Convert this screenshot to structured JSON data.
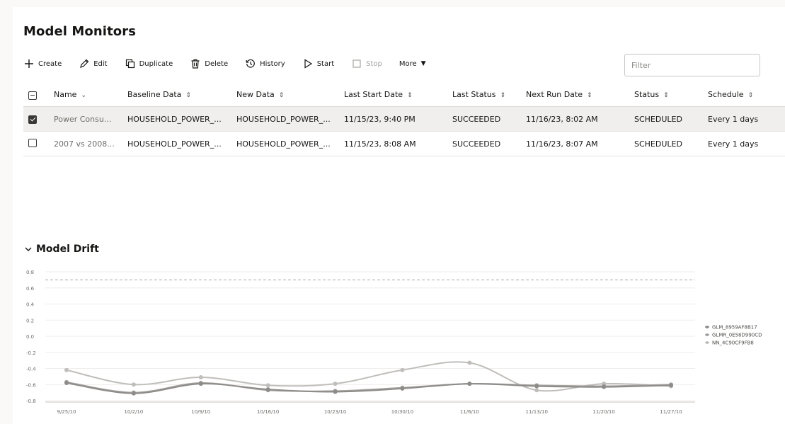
{
  "title": "Model Monitors",
  "toolbar": {
    "create": "Create",
    "edit": "Edit",
    "duplicate": "Duplicate",
    "delete": "Delete",
    "history": "History",
    "start": "Start",
    "stop": "Stop",
    "more": "More"
  },
  "filter": {
    "placeholder": "Filter"
  },
  "table": {
    "headers": [
      "Name",
      "Baseline Data",
      "New Data",
      "Last Start Date",
      "Last Status",
      "Next Run Date",
      "Status",
      "Schedule"
    ],
    "rows": [
      {
        "selected": true,
        "cells": [
          "Power Consu...",
          "HOUSEHOLD_POWER_...",
          "HOUSEHOLD_POWER_...",
          "11/15/23, 9:40 PM",
          "SUCCEEDED",
          "11/16/23, 8:02 AM",
          "SCHEDULED",
          "Every 1 days"
        ]
      },
      {
        "selected": false,
        "cells": [
          "2007 vs 2008...",
          "HOUSEHOLD_POWER_...",
          "HOUSEHOLD_POWER_...",
          "11/15/23, 8:08 AM",
          "SUCCEEDED",
          "11/16/23, 8:07 AM",
          "SCHEDULED",
          "Every 1 days"
        ]
      }
    ]
  },
  "drift": {
    "title": "Model Drift"
  },
  "chart_data": {
    "type": "line",
    "title": "",
    "xlabel": "",
    "ylabel": "",
    "x": [
      "9/25/10",
      "10/2/10",
      "10/9/10",
      "10/16/10",
      "10/23/10",
      "10/30/10",
      "11/6/10",
      "11/13/10",
      "11/20/10",
      "11/27/10"
    ],
    "ylim": [
      -0.8,
      0.8
    ],
    "yticks": [
      "0.8",
      "0.6",
      "0.4",
      "0.2",
      "0.0",
      "-0.2",
      "-0.4",
      "-0.6",
      "-0.8"
    ],
    "ytick_values": [
      0.8,
      0.6,
      0.4,
      0.2,
      0.0,
      -0.2,
      -0.4,
      -0.6,
      -0.8
    ],
    "threshold": 0.7,
    "grid": true,
    "legend_position": "right",
    "series": [
      {
        "name": "GLM_8959AF8B17",
        "color": "#8e8c89",
        "values": [
          -0.58,
          -0.71,
          -0.59,
          -0.66,
          -0.69,
          -0.65,
          -0.59,
          -0.62,
          -0.63,
          -0.61
        ]
      },
      {
        "name": "GLMR_0E58D990CD",
        "color": "#a3a19e",
        "values": [
          -0.57,
          -0.7,
          -0.58,
          -0.67,
          -0.68,
          -0.64,
          -0.59,
          -0.61,
          -0.62,
          -0.6
        ]
      },
      {
        "name": "NN_4C90CF9FB8",
        "color": "#c0bebb",
        "values": [
          -0.42,
          -0.6,
          -0.51,
          -0.61,
          -0.59,
          -0.42,
          -0.33,
          -0.67,
          -0.59,
          -0.62
        ]
      }
    ]
  }
}
